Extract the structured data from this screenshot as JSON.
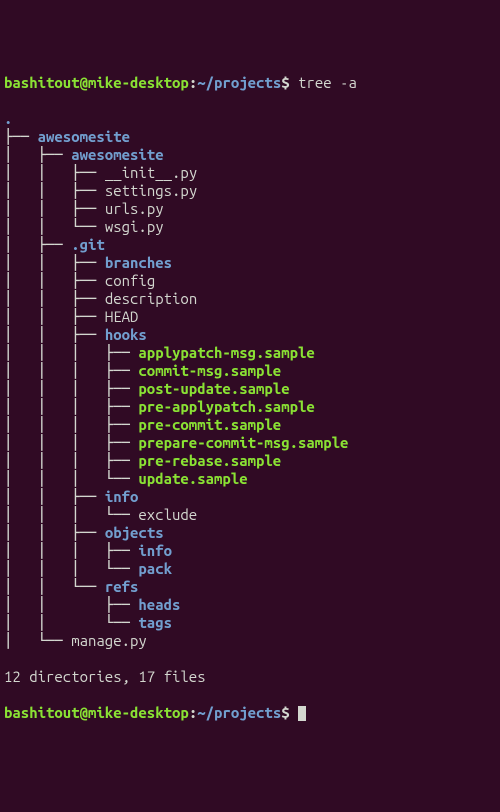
{
  "prompt": {
    "user_host": "bashitout@mike-desktop",
    "separator1": ":",
    "path": "~/projects",
    "separator2": "$ "
  },
  "command": "tree -a",
  "tree": [
    {
      "prefix": "",
      "kind": "dir",
      "text": "."
    },
    {
      "prefix": "├── ",
      "kind": "dir",
      "text": "awesomesite"
    },
    {
      "prefix": "│   ├── ",
      "kind": "dir",
      "text": "awesomesite"
    },
    {
      "prefix": "│   │   ├── ",
      "kind": "file",
      "text": "__init__.py"
    },
    {
      "prefix": "│   │   ├── ",
      "kind": "file",
      "text": "settings.py"
    },
    {
      "prefix": "│   │   ├── ",
      "kind": "file",
      "text": "urls.py"
    },
    {
      "prefix": "│   │   └── ",
      "kind": "file",
      "text": "wsgi.py"
    },
    {
      "prefix": "│   ├── ",
      "kind": "dir",
      "text": ".git"
    },
    {
      "prefix": "│   │   ├── ",
      "kind": "dir",
      "text": "branches"
    },
    {
      "prefix": "│   │   ├── ",
      "kind": "file",
      "text": "config"
    },
    {
      "prefix": "│   │   ├── ",
      "kind": "file",
      "text": "description"
    },
    {
      "prefix": "│   │   ├── ",
      "kind": "file",
      "text": "HEAD"
    },
    {
      "prefix": "│   │   ├── ",
      "kind": "dir",
      "text": "hooks"
    },
    {
      "prefix": "│   │   │   ├── ",
      "kind": "exec",
      "text": "applypatch-msg.sample"
    },
    {
      "prefix": "│   │   │   ├── ",
      "kind": "exec",
      "text": "commit-msg.sample"
    },
    {
      "prefix": "│   │   │   ├── ",
      "kind": "exec",
      "text": "post-update.sample"
    },
    {
      "prefix": "│   │   │   ├── ",
      "kind": "exec",
      "text": "pre-applypatch.sample"
    },
    {
      "prefix": "│   │   │   ├── ",
      "kind": "exec",
      "text": "pre-commit.sample"
    },
    {
      "prefix": "│   │   │   ├── ",
      "kind": "exec",
      "text": "prepare-commit-msg.sample"
    },
    {
      "prefix": "│   │   │   ├── ",
      "kind": "exec",
      "text": "pre-rebase.sample"
    },
    {
      "prefix": "│   │   │   └── ",
      "kind": "exec",
      "text": "update.sample"
    },
    {
      "prefix": "│   │   ├── ",
      "kind": "dir",
      "text": "info"
    },
    {
      "prefix": "│   │   │   └── ",
      "kind": "file",
      "text": "exclude"
    },
    {
      "prefix": "│   │   ├── ",
      "kind": "dir",
      "text": "objects"
    },
    {
      "prefix": "│   │   │   ├── ",
      "kind": "dir",
      "text": "info"
    },
    {
      "prefix": "│   │   │   └── ",
      "kind": "dir",
      "text": "pack"
    },
    {
      "prefix": "│   │   └── ",
      "kind": "dir",
      "text": "refs"
    },
    {
      "prefix": "│   │       ├── ",
      "kind": "dir",
      "text": "heads"
    },
    {
      "prefix": "│   │       └── ",
      "kind": "dir",
      "text": "tags"
    },
    {
      "prefix": "│   └── ",
      "kind": "file",
      "text": "manage.py"
    },
    {
      "prefix": "",
      "kind": "file",
      "text": ""
    }
  ],
  "summary": "12 directories, 17 files"
}
